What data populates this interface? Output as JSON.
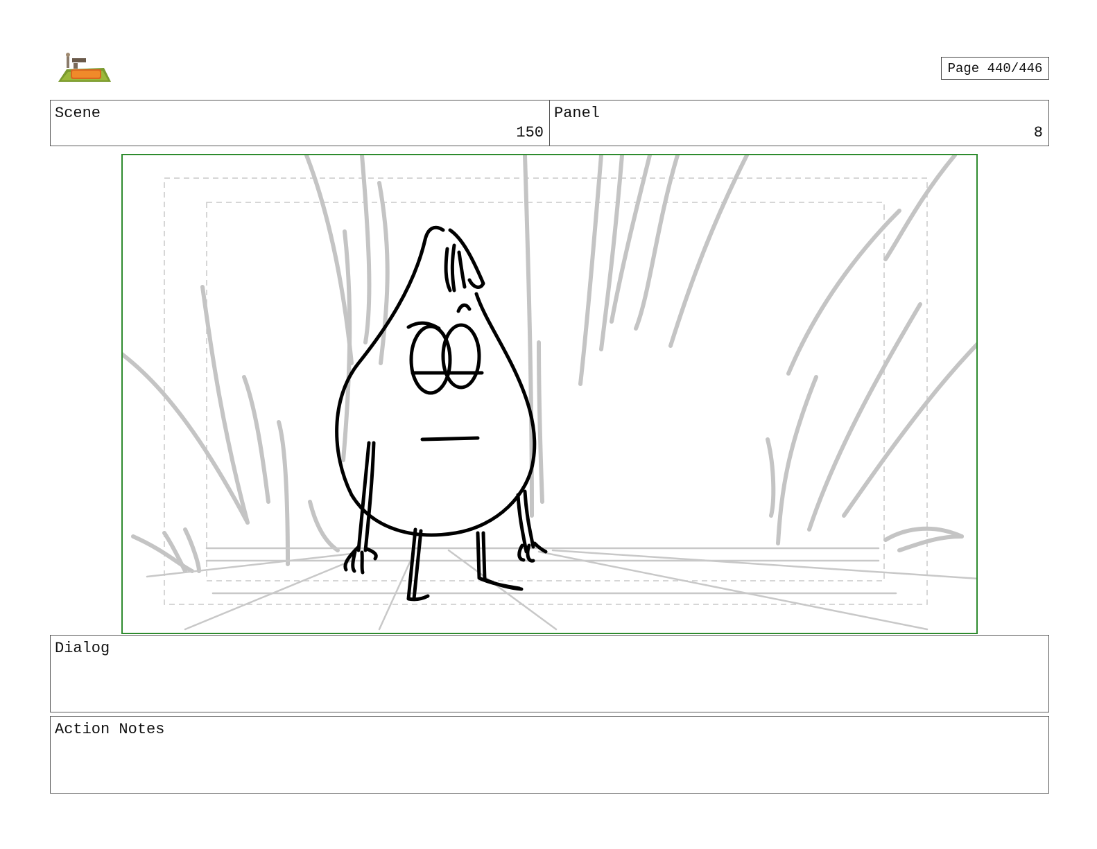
{
  "header": {
    "page_indicator": "Page 440/446"
  },
  "scene": {
    "label": "Scene",
    "value": "150"
  },
  "panel": {
    "label": "Panel",
    "value": "8"
  },
  "dialog": {
    "label": "Dialog",
    "text": ""
  },
  "action_notes": {
    "label": "Action Notes",
    "text": ""
  },
  "colors": {
    "frame_border": "#2e8b2e",
    "sketch_gray": "#c4c4c4",
    "ink": "#000000"
  }
}
